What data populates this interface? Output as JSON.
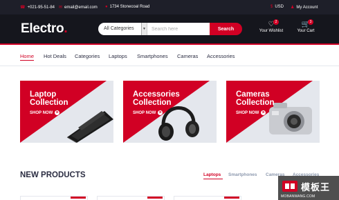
{
  "top_bar": {
    "phone": "+021-95-51-84",
    "email": "email@email.com",
    "address": "1734 Stonecoal Road",
    "currency": "USD",
    "account": "My Account",
    "icons": [
      "phone-icon",
      "envelope-icon",
      "map-marker-icon",
      "dollar-icon",
      "user-icon"
    ]
  },
  "header": {
    "logo_text": "Electro",
    "logo_dot": ".",
    "category_select": "All Categories",
    "search_placeholder": "Search here",
    "search_button": "Search",
    "wishlist_label": "Your Wishlist",
    "wishlist_count": "2",
    "cart_label": "Your Cart",
    "cart_count": "3"
  },
  "nav": {
    "items": [
      "Home",
      "Hot Deals",
      "Categories",
      "Laptops",
      "Smartphones",
      "Cameras",
      "Accessories"
    ],
    "active": "Home"
  },
  "collections": [
    {
      "line1": "Laptop",
      "line2": "Collection",
      "cta": "SHOP NOW"
    },
    {
      "line1": "Accessories",
      "line2": "Collection",
      "cta": "SHOP NOW"
    },
    {
      "line1": "Cameras",
      "line2": "Collection",
      "cta": "SHOP NOW"
    }
  ],
  "new_products": {
    "title": "NEW PRODUCTS",
    "tabs": [
      "Laptops",
      "Smartphones",
      "Cameras",
      "Accessories"
    ],
    "active_tab": "Laptops"
  },
  "watermark": {
    "cn_text": "模板王",
    "url": "MOBANWANG.COM"
  },
  "colors": {
    "accent": "#D10024",
    "header_dark": "#15161D",
    "topbar_dark": "#1E1F29",
    "panel_gray": "#E4E7ED",
    "text_dark": "#2B2D42",
    "text_muted": "#8D99AE"
  }
}
